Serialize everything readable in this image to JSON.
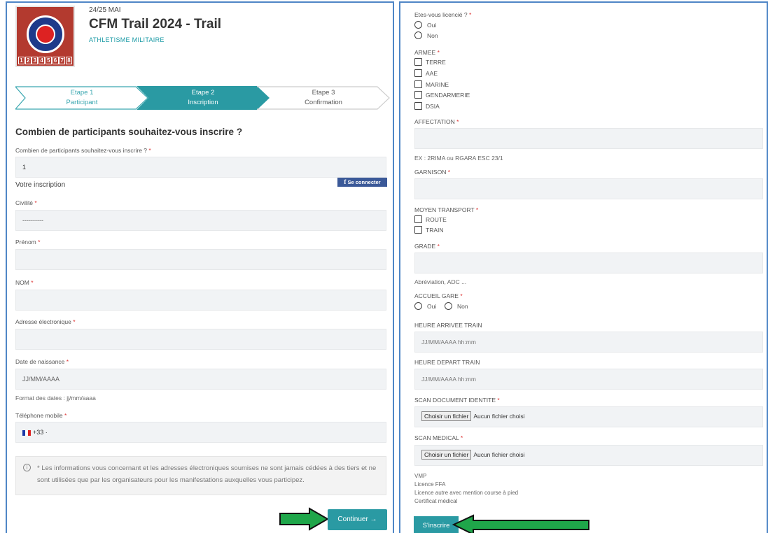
{
  "header": {
    "date": "24/25 MAI",
    "title": "CFM Trail 2024 - Trail",
    "subtitle": "ATHLETISME MILITAIRE",
    "logo_digits": [
      "1",
      "2",
      "3",
      "4",
      "5",
      "6",
      "7",
      "8"
    ]
  },
  "steps": [
    {
      "line1": "Etape 1",
      "line2": "Participant"
    },
    {
      "line1": "Etape 2",
      "line2": "Inscription"
    },
    {
      "line1": "Etape 3",
      "line2": "Confirmation"
    }
  ],
  "left": {
    "question_title": "Combien de participants souhaitez-vous inscrire ?",
    "count_label": "Combien de participants souhaitez-vous inscrire ?",
    "count_value": "1",
    "votre_inscription": "Votre inscription",
    "facebook_button": "Se connecter",
    "civilite_label": "Civilité",
    "civilite_value": "----------",
    "prenom_label": "Prénom",
    "nom_label": "NOM",
    "email_label": "Adresse électronique",
    "dob_label": "Date de naissance",
    "dob_placeholder": "JJ/MM/AAAA",
    "date_format_hint": "Format des dates : jj/mm/aaaa",
    "phone_label": "Téléphone mobile",
    "phone_prefix": "+33 ·",
    "info_text": "* Les informations vous concernant et les adresses électroniques soumises ne sont jamais cédées à des tiers et ne sont utilisées que par les organisateurs pour les manifestations auxquelles vous participez.",
    "continue_button": "Continuer →"
  },
  "right": {
    "licencie_label": "Etes-vous licencié ?",
    "licencie_options": [
      "Oui",
      "Non"
    ],
    "armee_label": "ARMEE",
    "armee_options": [
      "TERRE",
      "AAE",
      "MARINE",
      "GENDARMERIE",
      "DSIA"
    ],
    "affectation_label": "AFFECTATION",
    "affectation_hint": "EX : 2RIMA ou RGARA ESC 23/1",
    "garnison_label": "GARNISON",
    "transport_label": "MOYEN TRANSPORT",
    "transport_options": [
      "ROUTE",
      "TRAIN"
    ],
    "grade_label": "GRADE",
    "grade_hint": "Abréviation, ADC ...",
    "accueil_label": "ACCUEIL GARE",
    "accueil_options": [
      "Oui",
      "Non"
    ],
    "arrivee_label": "HEURE ARRIVEE TRAIN",
    "arrivee_placeholder": "JJ/MM/AAAA hh:mm",
    "depart_label": "HEURE DEPART TRAIN",
    "depart_placeholder": "JJ/MM/AAAA hh:mm",
    "scan_id_label": "SCAN DOCUMENT IDENTITE",
    "scan_med_label": "SCAN MEDICAL",
    "file_button": "Choisir un fichier",
    "file_none": "Aucun fichier choisi",
    "medical_notes": [
      "VMP",
      "Licence FFA",
      "Licence autre avec mention course à pied",
      "Certificat médical"
    ],
    "submit_button": "S'inscrire"
  },
  "required_marker": "*",
  "colors": {
    "accent": "#2a9aa3",
    "arrow": "#1fa64a",
    "border": "#4f86c6",
    "required": "#dd3333"
  }
}
